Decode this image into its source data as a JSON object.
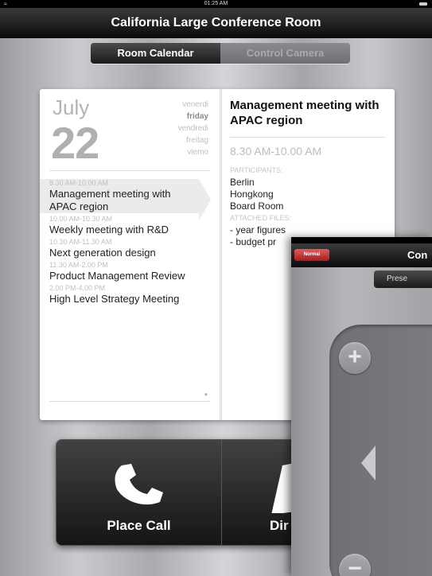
{
  "status_bar": {
    "time": "01:25 AM"
  },
  "title_bar": {
    "title": "California Large Conference Room"
  },
  "tabs": [
    {
      "label": "Room Calendar",
      "active": true
    },
    {
      "label": "Control Camera",
      "active": false
    }
  ],
  "calendar": {
    "month": "July",
    "day": "22",
    "weekdays": [
      "venerdi",
      "friday",
      "vendredi",
      "freitag",
      "viemo"
    ],
    "events": [
      {
        "time": "8.30 AM-10.00 AM",
        "name": "Management meeting with APAC region",
        "selected": true
      },
      {
        "time": "10.00 AM-10.30 AM",
        "name": "Weekly meeting with R&D"
      },
      {
        "time": "10.30 AM-11.30 AM",
        "name": "Next generation design"
      },
      {
        "time": "11.30 AM-2.00 PM",
        "name": "Product Management Review"
      },
      {
        "time": "2.00 PM-4.00 PM",
        "name": "High Level Strategy Meeting"
      }
    ],
    "scroll_glyph": "▼"
  },
  "detail": {
    "title": "Management meeting with APAC region",
    "time": "8.30 AM-10.00 AM",
    "participants_label": "PARTICIPANTS:",
    "participants": [
      "Berlin",
      "Hongkong",
      "Board Room"
    ],
    "files_label": "ATTACHED FILES:",
    "files": [
      "- year figures",
      "- budget pr"
    ]
  },
  "actions": [
    {
      "label": "Place Call",
      "icon": "phone-icon"
    },
    {
      "label": "Dir",
      "icon": "directory-icon"
    }
  ],
  "overlay": {
    "red_button_label": "Normal",
    "title": "Con",
    "tab_label": "Prese",
    "zoom_in_glyph": "+",
    "zoom_out_glyph": "−",
    "left_arrow_icon": "arrow-left-icon"
  }
}
